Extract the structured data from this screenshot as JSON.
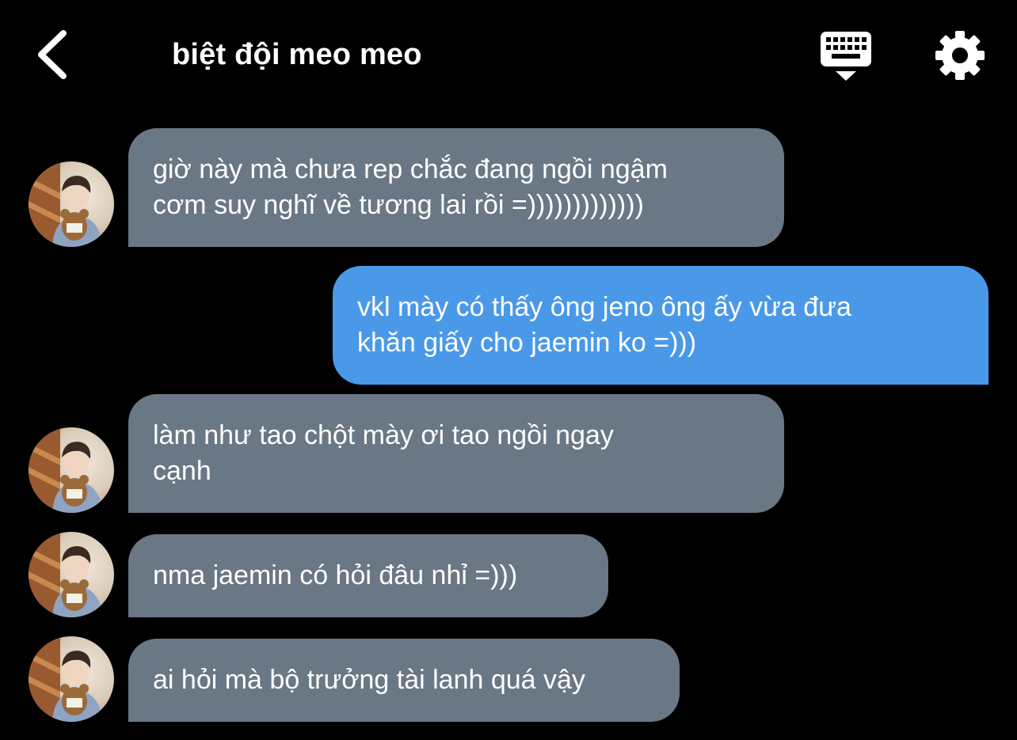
{
  "header": {
    "title": "biệt đội meo meo"
  },
  "icons": {
    "back": "chevron-left-icon",
    "keyboard": "keyboard-dismiss-icon",
    "settings": "gear-icon"
  },
  "colors": {
    "background": "#000000",
    "incoming_bubble": "#6a7785",
    "outgoing_bubble": "#4a99e9",
    "text": "#ffffff"
  },
  "messages": [
    {
      "direction": "incoming",
      "lines": [
        "giờ này mà chưa rep chắc đang ngồi ngậm",
        "cơm suy nghĩ về tương lai rồi =)))))))))))))"
      ]
    },
    {
      "direction": "outgoing",
      "lines": [
        "vkl mày có thấy ông jeno ông ấy vừa đưa",
        "khăn giấy cho jaemin ko =)))"
      ]
    },
    {
      "direction": "incoming",
      "lines": [
        "làm như tao chột mày ơi tao ngồi ngay",
        "cạnh"
      ]
    },
    {
      "direction": "incoming",
      "lines": [
        "nma jaemin có hỏi đâu nhỉ =)))"
      ]
    },
    {
      "direction": "incoming",
      "lines": [
        "ai hỏi mà bộ trưởng tài lanh quá vậy"
      ]
    }
  ]
}
